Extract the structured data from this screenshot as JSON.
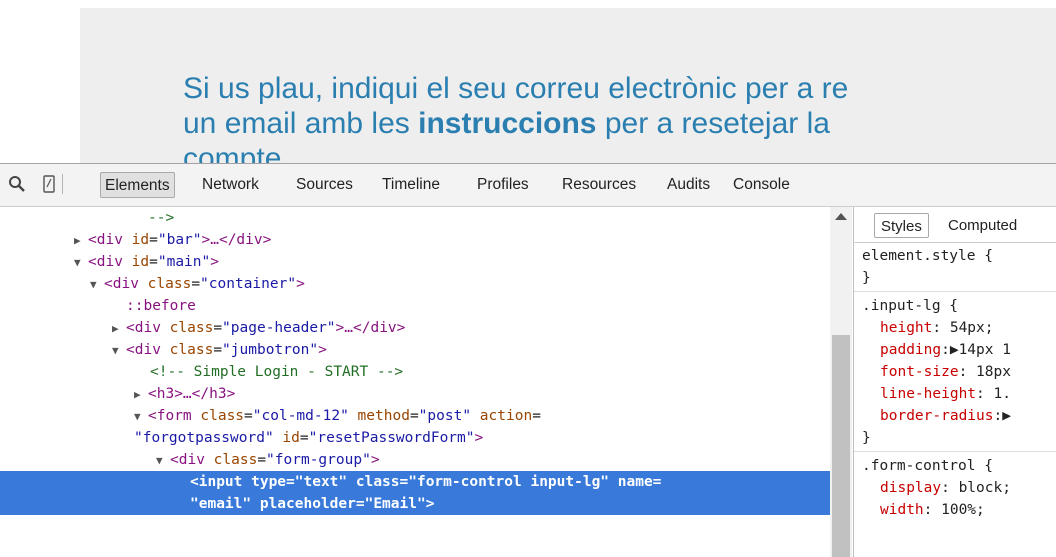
{
  "preview": {
    "line1": "Si us plau, indiqui el seu correu electrònic per a re",
    "line2_a": "un email amb les ",
    "line2_bold": "instruccions",
    "line2_b": " per a resetejar la",
    "line3": "compte"
  },
  "toolbar": {
    "tabs": [
      "Elements",
      "Network",
      "Sources",
      "Timeline",
      "Profiles",
      "Resources",
      "Audits",
      "Console"
    ],
    "selected_tab": "Elements",
    "icons": [
      "search-icon",
      "mobile-device-icon"
    ]
  },
  "tree": {
    "rows": {
      "r0": "-->",
      "r1_open": "<div ",
      "r1_attr": "id",
      "r1_val": "\"bar\"",
      "r1_close": ">…</div>",
      "r2_open": "<div ",
      "r2_attr": "id",
      "r2_val": "\"main\"",
      "r2_close": ">",
      "r3_open": "<div ",
      "r3_attr": "class",
      "r3_val": "\"container\"",
      "r3_close": ">",
      "r4": "::before",
      "r5_open": "<div ",
      "r5_attr": "class",
      "r5_val": "\"page-header\"",
      "r5_close": ">…</div>",
      "r6_open": "<div ",
      "r6_attr": "class",
      "r6_val": "\"jumbotron\"",
      "r6_close": ">",
      "r7": "<!-- Simple Login - START -->",
      "r8": "<h3>…</h3>",
      "r9_open": "<form ",
      "r9_a1": "class",
      "r9_v1": "\"col-md-12\"",
      "r9_a2": "method",
      "r9_v2": "\"post\"",
      "r9_a3": "action",
      "r10_v3": "\"forgotpassword\"",
      "r10_a4": "id",
      "r10_v4": "\"resetPasswordForm\"",
      "r10_close": ">",
      "r11_open": "<div ",
      "r11_attr": "class",
      "r11_val": "\"form-group\"",
      "r11_close": ">",
      "r12": "<input type=\"text\" class=\"form-control input-lg\" name=",
      "r13": "\"email\" placeholder=\"Email\">"
    }
  },
  "styles": {
    "tabs": [
      "Styles",
      "Computed"
    ],
    "selected_tab": "Styles",
    "lines": {
      "l0": "element.style {",
      "l1": "}",
      "l2": ".input-lg {",
      "l3_p": "height",
      "l3_v": ": 54px;",
      "l4_p": "padding",
      "l4_v": ":▶14px 1",
      "l5_p": "font-size",
      "l5_v": ": 18px",
      "l6_p": "line-height",
      "l6_v": ": 1.",
      "l7_p": "border-radius",
      "l7_v": ":▶",
      "l8": "}",
      "l9": ".form-control {",
      "l10_p": "display",
      "l10_v": ": block;",
      "l11_p": "width",
      "l11_v": ": 100%;"
    }
  }
}
